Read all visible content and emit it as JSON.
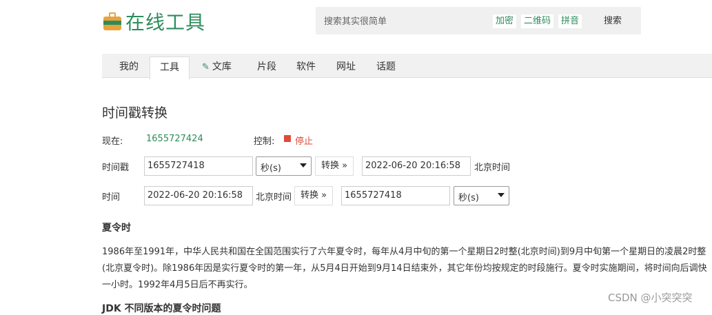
{
  "header": {
    "logo_text": "在线工具",
    "search_placeholder": "搜索其实很简单",
    "quick_links": [
      "加密",
      "二维码",
      "拼音"
    ],
    "search_button": "搜索"
  },
  "nav": {
    "tabs": [
      "我的",
      "工具",
      "文库",
      "片段",
      "软件",
      "网址",
      "话题"
    ],
    "active": "工具"
  },
  "page": {
    "title": "时间戳转换",
    "now_label": "现在:",
    "now_value": "1655727424",
    "control_label": "控制:",
    "stop_label": "停止",
    "row1": {
      "label": "时间戳",
      "input": "1655727418",
      "unit": "秒(s)",
      "convert": "转换 »",
      "output": "2022-06-20 20:16:58",
      "tz": "北京时间"
    },
    "row2": {
      "label": "时间",
      "input": "2022-06-20 20:16:58",
      "tz": "北京时间",
      "convert": "转换 »",
      "output": "1655727418",
      "unit": "秒(s)"
    },
    "section1_title": "夏令时",
    "section1_text": "1986年至1991年，中华人民共和国在全国范围实行了六年夏令时，每年从4月中旬的第一个星期日2时整(北京时间)到9月中旬第一个星期日的凌晨2时整(北京夏令时)。除1986年因是实行夏令时的第一年，从5月4日开始到9月14日结束外，其它年份均按规定的时段施行。夏令时实施期间，将时间向后调快一小时。1992年4月5日后不再实行。",
    "section2_title": "JDK 不同版本的夏令时问题"
  },
  "watermark": "CSDN @小突突突"
}
